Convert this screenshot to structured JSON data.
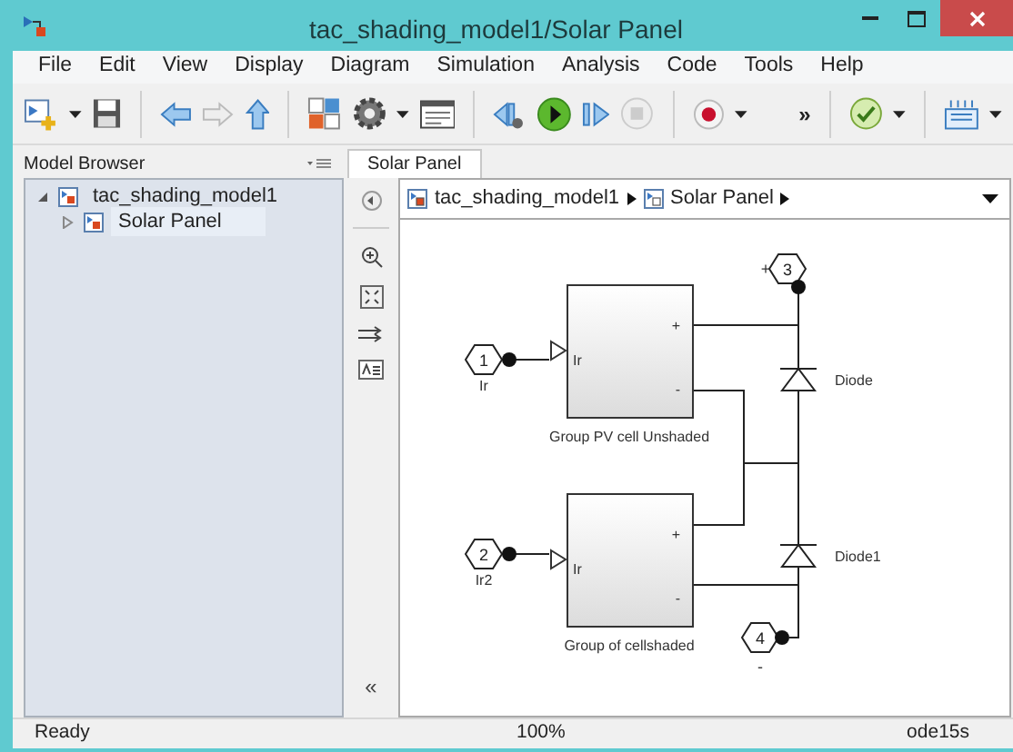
{
  "window": {
    "title": "tac_shading_model1/Solar Panel"
  },
  "menu": [
    "File",
    "Edit",
    "View",
    "Display",
    "Diagram",
    "Simulation",
    "Analysis",
    "Code",
    "Tools",
    "Help"
  ],
  "toolbar": {
    "overflow": "»"
  },
  "model_browser": {
    "title": "Model Browser",
    "collapse": "«",
    "tree": [
      {
        "label": "tac_shading_model1",
        "expanded": true,
        "selected": false,
        "children": [
          {
            "label": "Solar Panel",
            "expanded": false,
            "selected": true
          }
        ]
      }
    ]
  },
  "tabs": [
    {
      "label": "Solar Panel",
      "selected": true
    }
  ],
  "breadcrumb": [
    "tac_shading_model1",
    "Solar Panel"
  ],
  "diagram": {
    "subsystems": [
      {
        "label": "Group  PV cell Unshaded",
        "input": "Ir",
        "plus": "+",
        "minus": "-"
      },
      {
        "label": "Group of cellshaded",
        "input": "Ir",
        "plus": "+",
        "minus": "-"
      }
    ],
    "inports": [
      {
        "number": "1",
        "label": "Ir"
      },
      {
        "number": "2",
        "label": "Ir2"
      }
    ],
    "connection_ports": [
      {
        "number": "3",
        "sign": "+"
      },
      {
        "number": "4",
        "sign": "-"
      }
    ],
    "diodes": [
      {
        "label": "Diode"
      },
      {
        "label": "Diode1"
      }
    ]
  },
  "status_bar": {
    "status": "Ready",
    "zoom": "100%",
    "solver": "ode15s"
  }
}
